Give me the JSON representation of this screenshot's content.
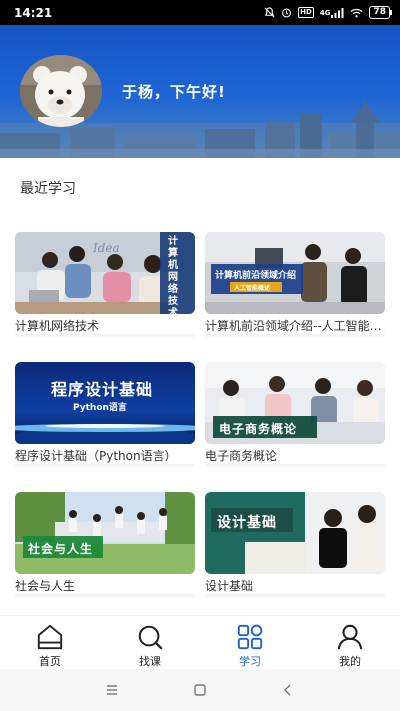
{
  "status_bar": {
    "time": "14:21",
    "icons": [
      "mute-icon",
      "alarm-icon",
      "hd-icon",
      "signal-icon",
      "wifi-icon"
    ],
    "hd_label": "HD",
    "network_label": "4G",
    "battery": "78"
  },
  "header": {
    "greeting": "于杨，下午好!",
    "avatar_icon": "polar-bear-avatar"
  },
  "recent": {
    "title": "最近学习",
    "courses": [
      {
        "title": "计算机网络技术",
        "thumb_text": "计算机网络技术",
        "thumb_deco": "Idea"
      },
      {
        "title": "计算机前沿领域介绍--人工智能概述",
        "thumb_text": "计算机前沿领域介绍",
        "thumb_sub": "人工智能概述"
      },
      {
        "title": "程序设计基础（Python语言）",
        "thumb_text": "程序设计基础",
        "thumb_sub": "Python语言"
      },
      {
        "title": "电子商务概论",
        "thumb_text": "电子商务概论"
      },
      {
        "title": "社会与人生",
        "thumb_text": "社会与人生"
      },
      {
        "title": "设计基础",
        "thumb_text": "设计基础"
      }
    ]
  },
  "bottom_nav": [
    {
      "label": "首页",
      "icon": "home-icon",
      "active": false
    },
    {
      "label": "找课",
      "icon": "search-icon",
      "active": false
    },
    {
      "label": "学习",
      "icon": "grid-icon",
      "active": true
    },
    {
      "label": "我的",
      "icon": "user-icon",
      "active": false
    }
  ],
  "colors": {
    "header_blue": "#1554c4",
    "accent": "#1e5fc8",
    "text": "#333333"
  },
  "system_nav": [
    "menu-icon",
    "home-square-icon",
    "back-icon"
  ]
}
